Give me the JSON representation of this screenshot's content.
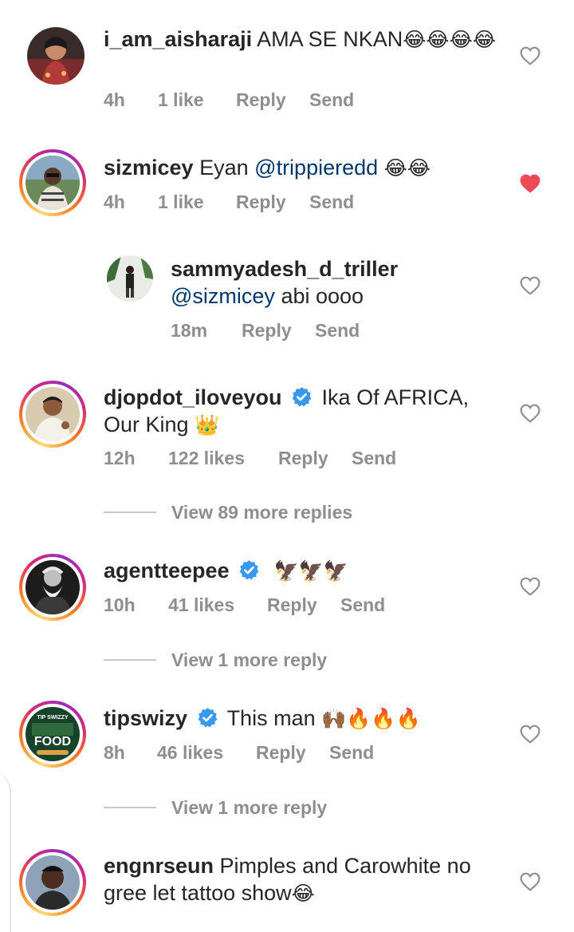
{
  "comments": [
    {
      "username": "i_am_aisharaji",
      "text": "AMA SE NKAN",
      "emoji": "😂😂😂😂",
      "time": "4h",
      "likes": "1 like",
      "reply_label": "Reply",
      "send_label": "Send",
      "liked": false,
      "verified": false
    },
    {
      "username": "sizmicey",
      "text": "Eyan",
      "mention": "@trippieredd",
      "emoji": "😂😂",
      "time": "4h",
      "likes": "1 like",
      "reply_label": "Reply",
      "send_label": "Send",
      "liked": true,
      "verified": false
    },
    {
      "username": "sammyadesh_d_triller",
      "mention": "@sizmicey",
      "text": "abi oooo",
      "time": "18m",
      "reply_label": "Reply",
      "send_label": "Send",
      "liked": false,
      "verified": false,
      "is_reply": true
    },
    {
      "username": "djopdot_iloveyou",
      "text": "Ika Of AFRICA, Our King",
      "emoji": "👑",
      "time": "12h",
      "likes": "122 likes",
      "reply_label": "Reply",
      "send_label": "Send",
      "liked": false,
      "verified": true,
      "view_more": "View 89 more replies"
    },
    {
      "username": "agentteepee",
      "emoji": "🦅🦅🦅",
      "time": "10h",
      "likes": "41 likes",
      "reply_label": "Reply",
      "send_label": "Send",
      "liked": false,
      "verified": true,
      "view_more": "View 1 more reply"
    },
    {
      "username": "tipswizy",
      "text": "This man",
      "emoji": "🙌🏾🔥🔥🔥",
      "time": "8h",
      "likes": "46 likes",
      "reply_label": "Reply",
      "send_label": "Send",
      "liked": false,
      "verified": true,
      "view_more": "View 1 more reply"
    },
    {
      "username": "engnrseun",
      "text": "Pimples and Carowhite no gree let tattoo show",
      "emoji": "😂",
      "liked": false,
      "verified": false
    }
  ],
  "avatar_food_label": {
    "top": "TIP SWIZZY",
    "main": "FOOD"
  },
  "colors": {
    "heart_liked": "#ed4956",
    "mention": "#00376b",
    "verified": "#3897f0",
    "meta": "#8e8e8e"
  }
}
